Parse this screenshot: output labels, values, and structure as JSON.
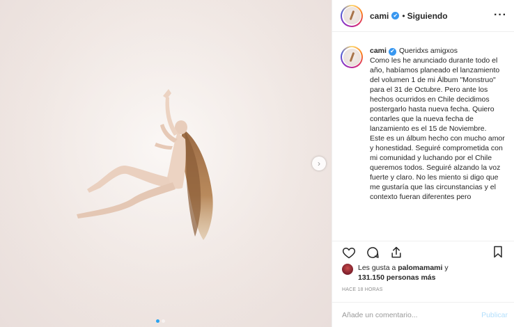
{
  "post": {
    "carousel_dots": 2,
    "active_dot": 0,
    "next_icon": "chevron-right-icon",
    "next_glyph": "›"
  },
  "header": {
    "username": "cami",
    "verified_icon": "verified-badge-icon",
    "verified_glyph": "✔",
    "separator": "•",
    "follow_label": "Siguiendo",
    "more_glyph": "···"
  },
  "caption": {
    "username": "cami",
    "verified_glyph": "✔",
    "text": "Queridxs amigxos\nComo les he anunciado durante todo el año, habíamos planeado el lanzamiento del volumen 1 de mi Álbum \"Monstruo\" para el 31 de Octubre. Pero ante los hechos ocurridos en Chile decidimos postergarlo hasta nueva fecha. Quiero contarles que la nueva fecha de lanzamiento es el 15 de Noviembre.\nEste es un álbum hecho con mucho amor y honestidad. Seguiré comprometida con mi comunidad y luchando por el Chile queremos todos. Seguiré alzando la voz fuerte y claro. No les miento si digo que me gustaría que las circunstancias y el contexto fueran diferentes pero"
  },
  "actions": {
    "like_icon": "heart-icon",
    "comment_icon": "comment-icon",
    "share_icon": "share-icon",
    "save_icon": "bookmark-icon"
  },
  "likes": {
    "prefix": "Les gusta a ",
    "user": "palomamami",
    "middle": " y",
    "count": "131.150 personas más"
  },
  "timestamp": "HACE 18 HORAS",
  "comment": {
    "placeholder": "Añade un comentario...",
    "publish_label": "Publicar"
  },
  "colors": {
    "accent": "#3897f0",
    "publish_disabled": "#b2dffc",
    "text": "#262626",
    "muted": "#8e8e8e"
  }
}
